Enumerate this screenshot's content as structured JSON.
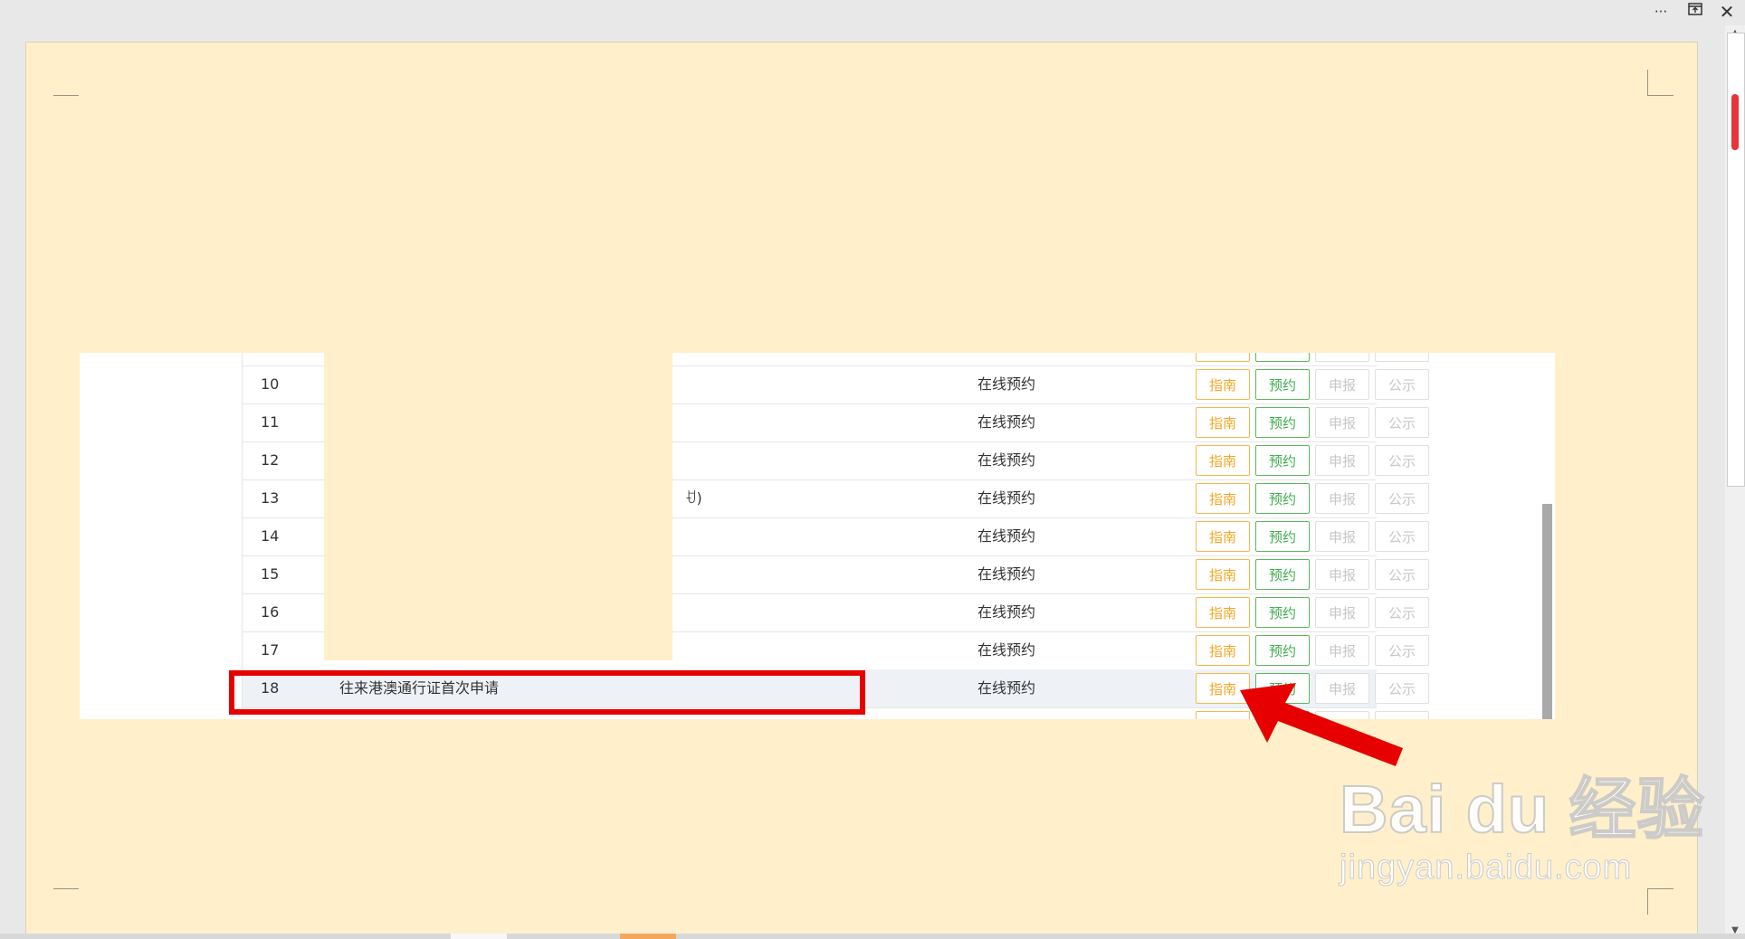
{
  "window": {
    "more_icon": "more-icon",
    "restore_icon": "restore-icon",
    "close_icon": "close-icon"
  },
  "table": {
    "rows": [
      {
        "num": "",
        "name": "",
        "status": "",
        "partial": true
      },
      {
        "num": "10",
        "name": "",
        "status": "在线预约"
      },
      {
        "num": "11",
        "name": "",
        "status": "在线预约"
      },
      {
        "num": "12",
        "name": "",
        "status": "在线预约"
      },
      {
        "num": "13",
        "name": "ꀀ)",
        "status": "在线预约"
      },
      {
        "num": "14",
        "name": "",
        "status": "在线预约"
      },
      {
        "num": "15",
        "name": "",
        "status": "在线预约"
      },
      {
        "num": "16",
        "name": "",
        "status": "在线预约"
      },
      {
        "num": "17",
        "name": "",
        "status": "在线预约"
      },
      {
        "num": "18",
        "name": "往来港澳通行证首次申请",
        "status": "在线预约",
        "highlighted": true
      }
    ],
    "buttons": {
      "guide": "指南",
      "book": "预约",
      "declare": "申报",
      "publicity": "公示"
    }
  },
  "watermark": {
    "main": "Bai du 经验",
    "sub": "jingyan.baidu.com"
  },
  "colors": {
    "page_bg": "#fff0cb",
    "highlight_box": "#e60000",
    "guide_btn": "#f5a623",
    "book_btn": "#3fae4f",
    "disabled_btn": "#c8c8c8",
    "scroll_thumb": "#e8343a"
  }
}
